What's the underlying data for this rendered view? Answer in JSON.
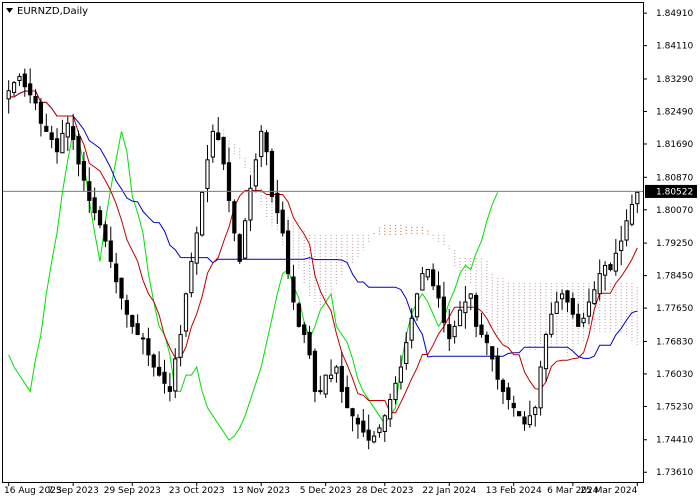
{
  "window": {
    "title": "EURNZD,Daily",
    "menu_icon": "triangle-down-icon"
  },
  "price_tag": "1.80522",
  "colors": {
    "background": "#ffffff",
    "frame": "#000000",
    "candles": "#000000",
    "tenkan": "#c00000",
    "kijun": "#0000c8",
    "chikou": "#00e000",
    "kumo": "#e07040",
    "kumo_b": "#c8a0b4",
    "price_line": "#708090",
    "price_tag_bg": "#000000",
    "price_tag_fg": "#ffffff"
  },
  "chart_data": {
    "type": "candlestick",
    "indicator": "Ichimoku Kinko Hyo",
    "y_ticks": [
      "1.84910",
      "1.84110",
      "1.83290",
      "1.82490",
      "1.81690",
      "1.80870",
      "1.80070",
      "1.79250",
      "1.78450",
      "1.77650",
      "1.76830",
      "1.76030",
      "1.75230",
      "1.74410",
      "1.73610"
    ],
    "x_ticks": [
      "16 Aug 2023",
      "7 Sep 2023",
      "29 Sep 2023",
      "23 Oct 2023",
      "13 Nov 2023",
      "5 Dec 2023",
      "28 Dec 2023",
      "22 Jan 2024",
      "13 Feb 2024",
      "6 Mar 2024",
      "25 Mar 2024"
    ],
    "ylim": [
      1.7337,
      1.8516
    ],
    "last_price": 1.80522,
    "close": [
      1.83,
      1.832,
      1.8335,
      1.831,
      1.829,
      1.827,
      1.822,
      1.82,
      1.818,
      1.815,
      1.8195,
      1.822,
      1.818,
      1.812,
      1.808,
      1.803,
      1.8,
      1.797,
      1.793,
      1.788,
      1.783,
      1.779,
      1.775,
      1.772,
      1.77,
      1.769,
      1.765,
      1.762,
      1.76,
      1.758,
      1.756,
      1.764,
      1.77,
      1.78,
      1.788,
      1.795,
      1.805,
      1.813,
      1.82,
      1.818,
      1.812,
      1.803,
      1.795,
      1.788,
      1.798,
      1.806,
      1.813,
      1.82,
      1.815,
      1.804,
      1.8,
      1.795,
      1.785,
      1.778,
      1.772,
      1.77,
      1.765,
      1.756,
      1.756,
      1.76,
      1.76,
      1.762,
      1.756,
      1.752,
      1.75,
      1.748,
      1.746,
      1.744,
      1.745,
      1.747,
      1.75,
      1.754,
      1.758,
      1.762,
      1.768,
      1.774,
      1.78,
      1.785,
      1.786,
      1.782,
      1.779,
      1.773,
      1.769,
      1.772,
      1.776,
      1.778,
      1.78,
      1.772,
      1.77,
      1.768,
      1.764,
      1.759,
      1.756,
      1.754,
      1.752,
      1.75,
      1.748,
      1.75,
      1.752,
      1.762,
      1.77,
      1.775,
      1.778,
      1.78,
      1.778,
      1.775,
      1.772,
      1.774,
      1.778,
      1.781,
      1.785,
      1.787,
      1.786,
      1.79,
      1.793,
      1.798,
      1.802,
      1.805
    ]
  }
}
